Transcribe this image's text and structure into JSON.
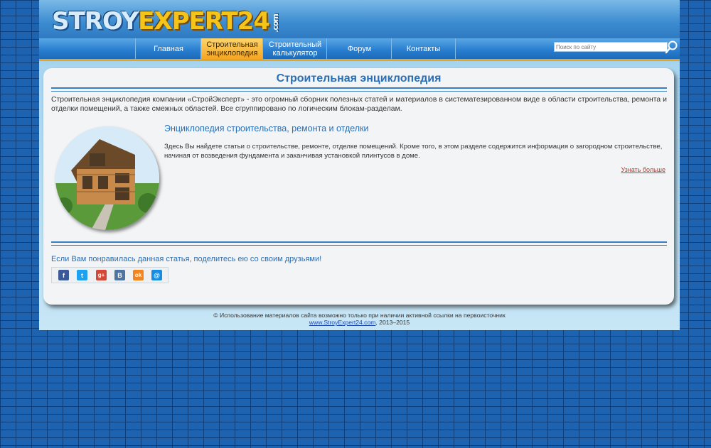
{
  "header": {
    "logo_part1": "STROY",
    "logo_part2": "EXPERT24",
    "logo_domain": ".com"
  },
  "nav": {
    "items": [
      {
        "label": "Главная"
      },
      {
        "label": "Строительная\nэнциклопедия"
      },
      {
        "label": "Строительный\nкалькулятор"
      },
      {
        "label": "Форум"
      },
      {
        "label": "Контакты"
      }
    ],
    "active_index": 1
  },
  "search": {
    "placeholder": "Поиск по сайту",
    "icon": "search-icon"
  },
  "main": {
    "title": "Строительная энциклопедия",
    "intro": "Строительная энциклопедия компании «СтройЭксперт» - это огромный сборник полезных статей и материалов в систематезированном виде в области строительства, ремонта и отделки помещений, а также смежных областей. Все сгруппировано по логическим блокам-разделам.",
    "article": {
      "title": "Энциклопедия строительства, ремонта и отделки",
      "text": "Здесь Вы найдете статьи о строительстве, ремонте, отделке помещений. Кроме того, в этом разделе содержится информация о загородном строительстве, начиная от возведения фундамента и заканчивая установкой плинтусов в доме.",
      "more_label": "Узнать больше"
    },
    "share": {
      "text": "Если Вам понравилась данная статья, поделитесь ею со своим друзьями!",
      "buttons": [
        {
          "label": "f",
          "name": "facebook-icon",
          "color": "#3b5998"
        },
        {
          "label": "t",
          "name": "twitter-icon",
          "color": "#1da1f2"
        },
        {
          "label": "g+",
          "name": "google-plus-icon",
          "color": "#d34836"
        },
        {
          "label": "B",
          "name": "vkontakte-icon",
          "color": "#4c75a3"
        },
        {
          "label": "ok",
          "name": "odnoklassniki-icon",
          "color": "#f2851f"
        },
        {
          "label": "@",
          "name": "mailru-icon",
          "color": "#168de2"
        }
      ]
    }
  },
  "footer": {
    "copyright": "© Использование материалов сайта возможно только при наличии активной ссылки на первоисточник",
    "link": "www.StroyExpert24.com",
    "years": ", 2013–2015"
  },
  "colors": {
    "accent": "#2a6fb5",
    "nav_active": "#f4a623",
    "link_red": "#c0392b"
  }
}
